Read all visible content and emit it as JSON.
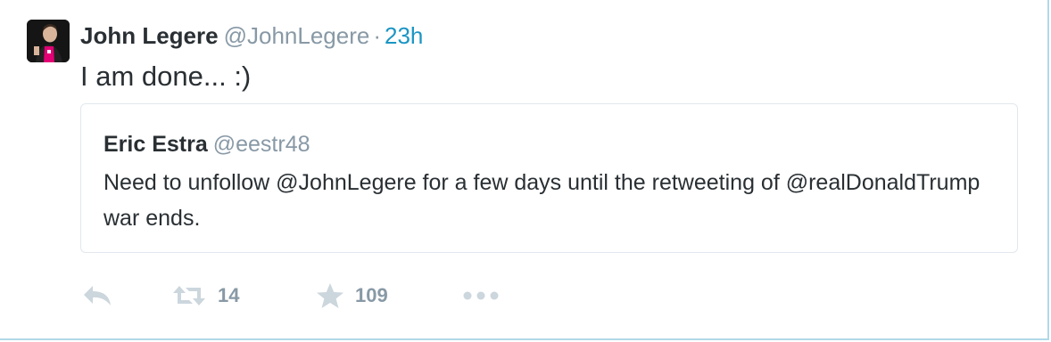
{
  "tweet": {
    "fullname": "John Legere",
    "username": "@JohnLegere",
    "separator": "·",
    "time": "23h",
    "text": "I am done... :)"
  },
  "quoted_tweet": {
    "fullname": "Eric Estra",
    "username": "@eestr48",
    "text": "Need to unfollow @JohnLegere for a few days until the retweeting of @realDonaldTrump war ends."
  },
  "actions": {
    "retweet_count": "14",
    "like_count": "109"
  },
  "colors": {
    "link": "#1b95c4",
    "muted": "#8899a6",
    "text": "#292f33",
    "border": "#e1e8ed",
    "icon": "#ccd6dd"
  },
  "icons": [
    "reply-icon",
    "retweet-icon",
    "star-icon",
    "more-icon"
  ]
}
